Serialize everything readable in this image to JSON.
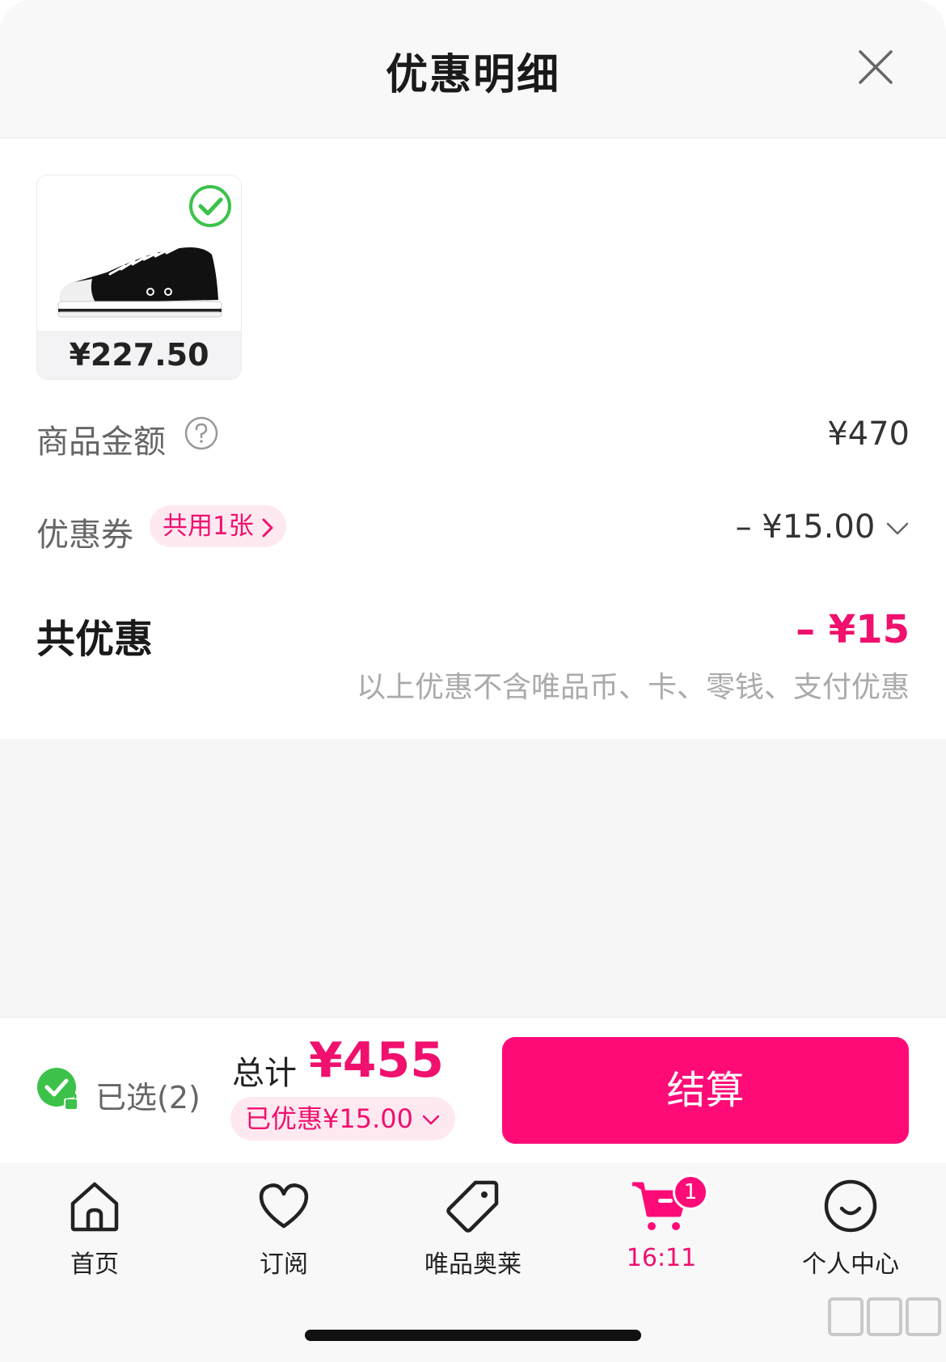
{
  "header": {
    "title": "优惠明细"
  },
  "product": {
    "price": "¥227.50"
  },
  "rows": {
    "goods_amount": {
      "label": "商品金额",
      "value": "¥470"
    },
    "coupon": {
      "label": "优惠券",
      "chip": "共用1张",
      "value": "– ¥15.00"
    }
  },
  "total_discount": {
    "label": "共优惠",
    "value": "– ¥15",
    "note": "以上优惠不含唯品币、卡、零钱、支付优惠"
  },
  "checkout_bar": {
    "selected": "已选(2)",
    "total_label": "总计",
    "total_value": "¥455",
    "discount": "已优惠¥15.00",
    "button": "结算"
  },
  "tabbar": {
    "items": [
      {
        "label": "首页",
        "icon": "home-icon"
      },
      {
        "label": "订阅",
        "icon": "heart-icon"
      },
      {
        "label": "唯品奥莱",
        "icon": "tag-icon"
      },
      {
        "label": "16:11",
        "icon": "cart-icon",
        "badge": "1",
        "active": true
      },
      {
        "label": "个人中心",
        "icon": "smile-icon"
      }
    ]
  },
  "colors": {
    "accent": "#ff0b78",
    "accent_text": "#f0106e",
    "check_green": "#3cc24a"
  }
}
